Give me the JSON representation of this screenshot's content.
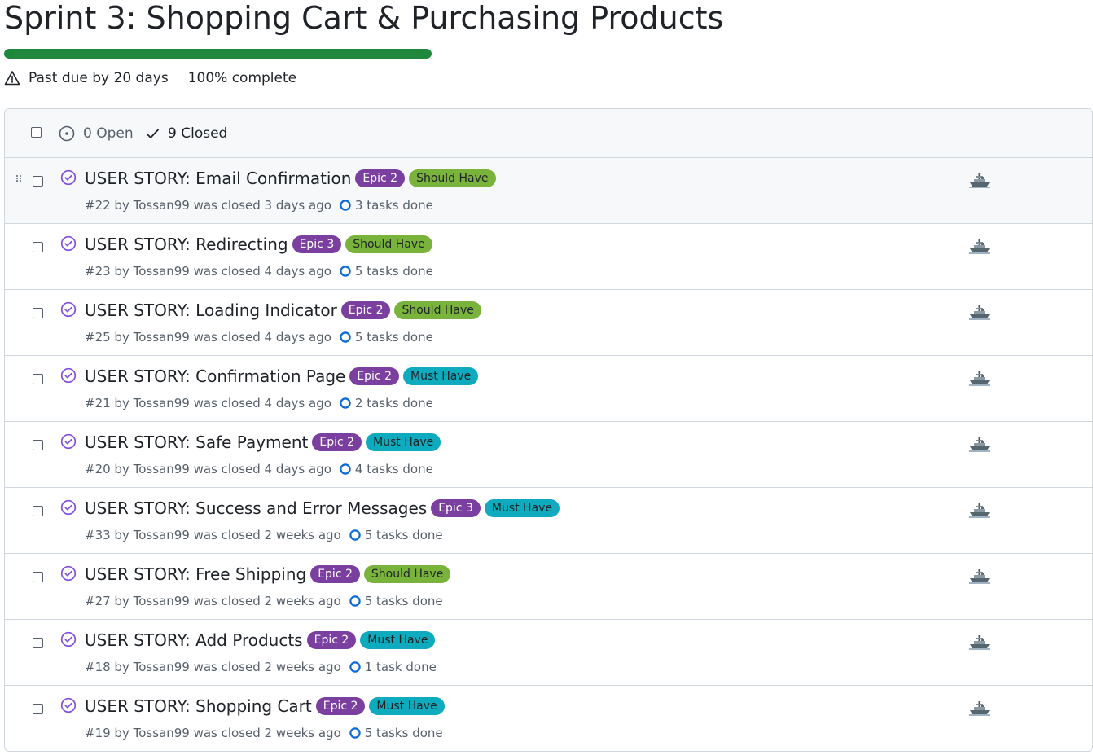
{
  "milestone": {
    "title": "Sprint 3: Shopping Cart & Purchasing Products",
    "progress_percent": 100,
    "due_status": "Past due by 20 days",
    "complete_text": "100% complete",
    "colors": {
      "progress": "#1f883d",
      "epic": "#7b3fa0",
      "should_have": "#79b33b",
      "must_have": "#0eaabd",
      "closed_icon": "#8250df",
      "task_ring": "#0969da"
    }
  },
  "filters": {
    "open_label": "0 Open",
    "closed_label": "9 Closed"
  },
  "issues": [
    {
      "title": "USER STORY: Email Confirmation",
      "epic": "Epic 2",
      "priority": "Should Have",
      "priority_kind": "should",
      "meta": "#22 by Tossan99 was closed 3 days ago",
      "tasks": "3 tasks done",
      "hovered": true
    },
    {
      "title": "USER STORY: Redirecting",
      "epic": "Epic 3",
      "priority": "Should Have",
      "priority_kind": "should",
      "meta": "#23 by Tossan99 was closed 4 days ago",
      "tasks": "5 tasks done"
    },
    {
      "title": "USER STORY: Loading Indicator",
      "epic": "Epic 2",
      "priority": "Should Have",
      "priority_kind": "should",
      "meta": "#25 by Tossan99 was closed 4 days ago",
      "tasks": "5 tasks done"
    },
    {
      "title": "USER STORY: Confirmation Page",
      "epic": "Epic 2",
      "priority": "Must Have",
      "priority_kind": "must",
      "meta": "#21 by Tossan99 was closed 4 days ago",
      "tasks": "2 tasks done"
    },
    {
      "title": "USER STORY: Safe Payment",
      "epic": "Epic 2",
      "priority": "Must Have",
      "priority_kind": "must",
      "meta": "#20 by Tossan99 was closed 4 days ago",
      "tasks": "4 tasks done"
    },
    {
      "title": "USER STORY: Success and Error Messages",
      "epic": "Epic 3",
      "priority": "Must Have",
      "priority_kind": "must",
      "meta": "#33 by Tossan99 was closed 2 weeks ago",
      "tasks": "5 tasks done"
    },
    {
      "title": "USER STORY: Free Shipping",
      "epic": "Epic 2",
      "priority": "Should Have",
      "priority_kind": "should",
      "meta": "#27 by Tossan99 was closed 2 weeks ago",
      "tasks": "5 tasks done"
    },
    {
      "title": "USER STORY: Add Products",
      "epic": "Epic 2",
      "priority": "Must Have",
      "priority_kind": "must",
      "meta": "#18 by Tossan99 was closed 2 weeks ago",
      "tasks": "1 task done"
    },
    {
      "title": "USER STORY: Shopping Cart",
      "epic": "Epic 2",
      "priority": "Must Have",
      "priority_kind": "must",
      "meta": "#19 by Tossan99 was closed 2 weeks ago",
      "tasks": "5 tasks done"
    }
  ],
  "icons": {
    "warning": "alert-triangle-icon",
    "open": "issue-open-icon",
    "closed_filter": "check-icon",
    "closed_issue": "issue-closed-icon",
    "tasks": "task-progress-icon",
    "assignee": "ship-avatar-icon",
    "drag": "drag-handle-icon"
  }
}
